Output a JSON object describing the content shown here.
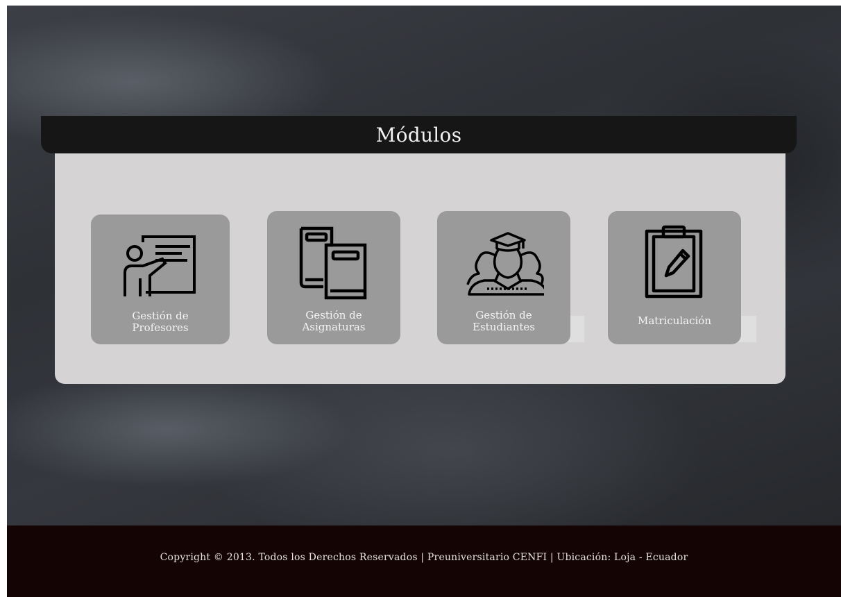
{
  "header": {
    "title": "Módulos"
  },
  "modules": [
    {
      "label": "Gestión de\nProfesores",
      "icon": "teacher-board-icon"
    },
    {
      "label": "Gestión de\nAsignaturas",
      "icon": "books-icon"
    },
    {
      "label": "Gestión de\nEstudiantes",
      "icon": "graduate-student-icon"
    },
    {
      "label": "Matriculación",
      "icon": "clipboard-pencil-icon"
    }
  ],
  "footer": {
    "text": "Copyright © 2013. Todos los Derechos Reservados | Preuniversitario CENFI | Ubicación: Loja - Ecuador"
  },
  "colors": {
    "header_bar": "#161616",
    "panel": "#d5d3d4",
    "module_tile": "#9a9a9a",
    "footer": "#150404"
  }
}
